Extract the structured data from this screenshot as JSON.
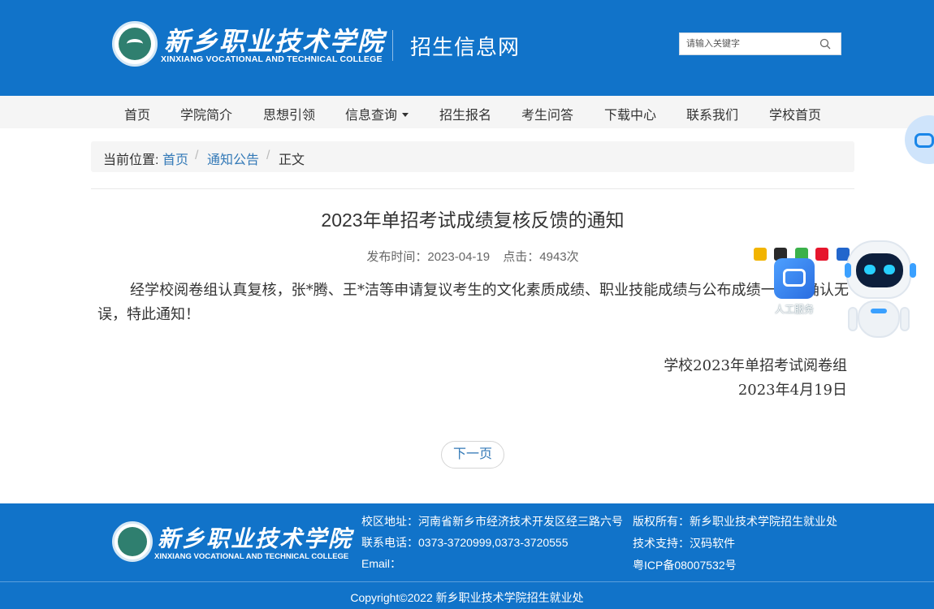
{
  "header": {
    "logo_cn": "新乡职业技术学院",
    "logo_en": "XINXIANG VOCATIONAL AND TECHNICAL COLLEGE",
    "site_name": "招生信息网",
    "search_placeholder": "请输入关键字"
  },
  "nav": {
    "items": [
      "首页",
      "学院简介",
      "思想引领",
      "信息查询",
      "招生报名",
      "考生问答",
      "下载中心",
      "联系我们",
      "学校首页"
    ]
  },
  "breadcrumb": {
    "label": "当前位置:",
    "home": "首页",
    "sep": "/",
    "section": "通知公告",
    "current": "正文"
  },
  "article": {
    "title": "2023年单招考试成绩复核反馈的通知",
    "publish_time": "发布时间：2023-04-19",
    "clicks": "点击：4943次",
    "body": "经学校阅卷组认真复核，张*腾、王*洁等申请复议考生的文化素质成绩、职业技能成绩与公布成绩一致，确认无误，特此通知！",
    "sign_org": "学校2023年单招考试阅卷组",
    "sign_date": "2023年4月19日"
  },
  "share_icons": [
    {
      "name": "qzone-icon",
      "color": "#f2b400"
    },
    {
      "name": "qq-icon",
      "color": "#2a2a2a"
    },
    {
      "name": "wechat-icon",
      "color": "#3bb14a"
    },
    {
      "name": "weibo-icon",
      "color": "#e6162d"
    },
    {
      "name": "renren-icon",
      "color": "#2266cc"
    }
  ],
  "pagination": {
    "next": "下一页"
  },
  "assistant": {
    "label": "人工服务"
  },
  "footer": {
    "logo_cn": "新乡职业技术学院",
    "logo_en": "XINXIANG VOCATIONAL AND TECHNICAL COLLEGE",
    "address": "校区地址：河南省新乡市经济技术开发区经三路六号",
    "phone": "联系电话：0373-3720999,0373-3720555",
    "email": "Email：",
    "copyright_owner": "版权所有：新乡职业技术学院招生就业处",
    "tech_support": "技术支持：汉码软件",
    "icp": "粤ICP备08007532号",
    "copyright": "Copyright©2022 新乡职业技术学院招生就业处"
  },
  "colors": {
    "brand_blue": "#1173c9",
    "link_blue": "#3379b7"
  }
}
